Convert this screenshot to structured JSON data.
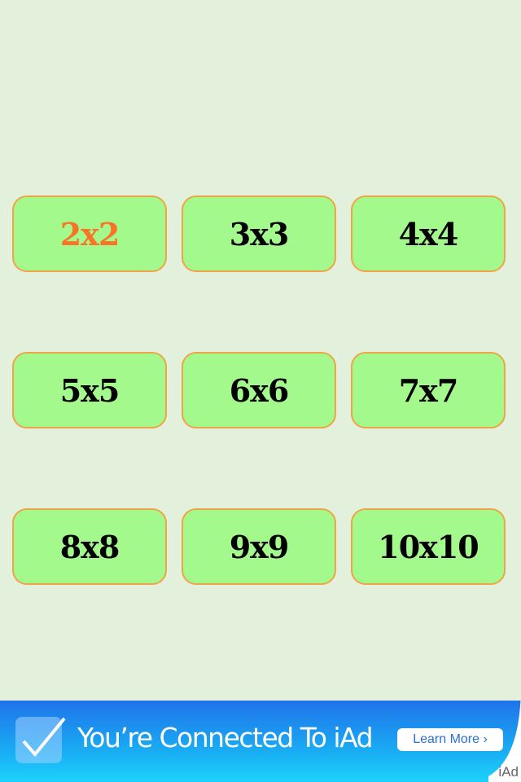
{
  "grid": {
    "buttons": [
      {
        "label": "2x2",
        "selected": true
      },
      {
        "label": "3x3",
        "selected": false
      },
      {
        "label": "4x4",
        "selected": false
      },
      {
        "label": "5x5",
        "selected": false
      },
      {
        "label": "6x6",
        "selected": false
      },
      {
        "label": "7x7",
        "selected": false
      },
      {
        "label": "8x8",
        "selected": false
      },
      {
        "label": "9x9",
        "selected": false
      },
      {
        "label": "10x10",
        "selected": false
      }
    ],
    "colors": {
      "button_bg": "#a4f98c",
      "button_border": "#eda545",
      "selected_text": "#fb7325",
      "text": "#000000",
      "page_bg": "#e3f0dc"
    }
  },
  "ad": {
    "icon": "checkmark-icon",
    "message": "You’re Connected To iAd",
    "learn_more": "Learn More ›",
    "brand": "iAd"
  }
}
